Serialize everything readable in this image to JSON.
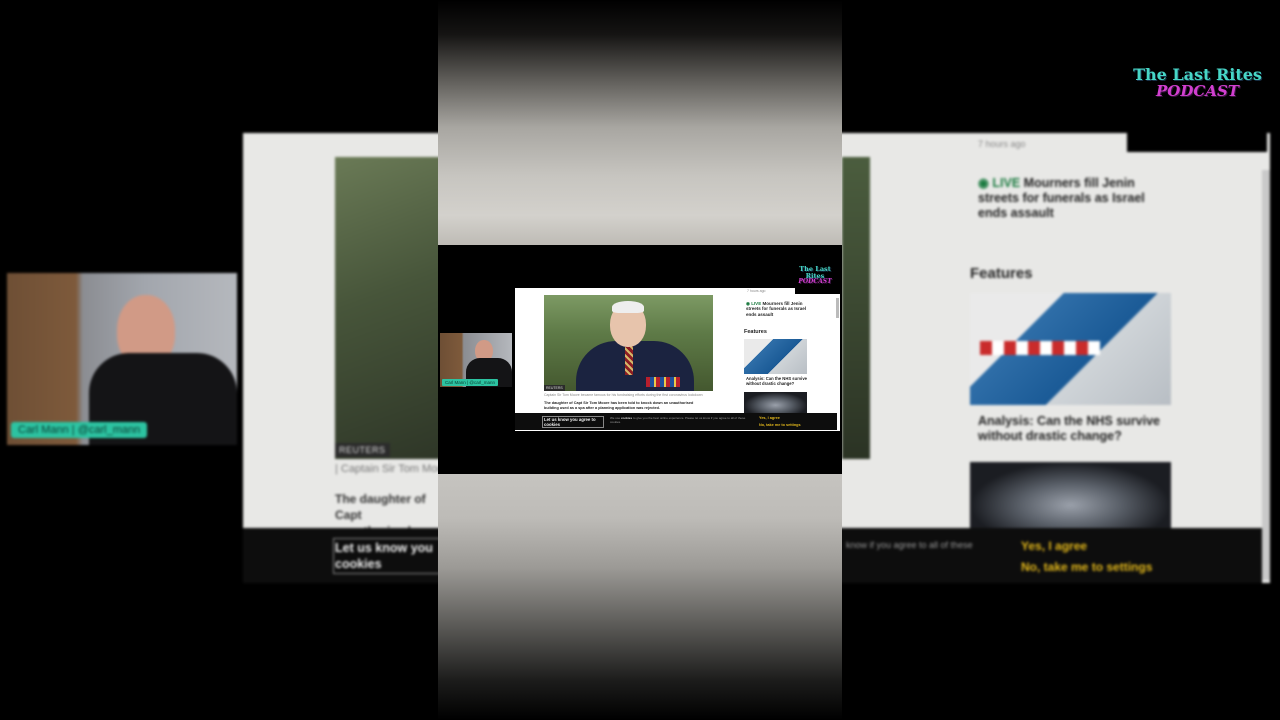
{
  "podcast_logo": {
    "line1": "The Last Rites",
    "line2": "PODCAST"
  },
  "streamer": {
    "name_tag": "Carl Mann | @carl_mann"
  },
  "article": {
    "photo_credit": "REUTERS",
    "photo_caption": "Captain Sir Tom Moore became famous for his fundraising efforts during the first coronavirus lockdown",
    "photo_caption_visible": "Captain Sir Tom Moore",
    "body_lead": "The daughter of Capt Sir Tom Moore has been told to knock down an unauthorised building used as a spa after a planning application was rejected.",
    "body_lead_visible": "The daughter of Capt unauthorised buildi rejected"
  },
  "sidebar": {
    "timestamp": "7 hours ago",
    "live_label": "LIVE",
    "live_headline": "Mourners fill Jenin streets for funerals as Israel ends assault",
    "features_heading": "Features",
    "feature1_caption": "Analysis: Can the NHS survive without drastic change?"
  },
  "cookie_banner": {
    "title": "Let us know you agree to cookies",
    "title_visible": "Let us know you cookies",
    "text_visible": "know if you agree to all of these",
    "mini_text_pre": "We use",
    "mini_text_link": "cookies",
    "mini_text_post": "to give you the best online experience. Please let us know if you agree to all of these cookies.",
    "yes_label": "Yes, I agree",
    "no_label": "No, take me to settings"
  },
  "colors": {
    "live_green": "#1a7a3f",
    "cookie_yellow": "#e3b81b",
    "logo_teal": "#47d6c6",
    "logo_magenta": "#d13fcf",
    "name_tag_teal": "#2cc3a1"
  }
}
